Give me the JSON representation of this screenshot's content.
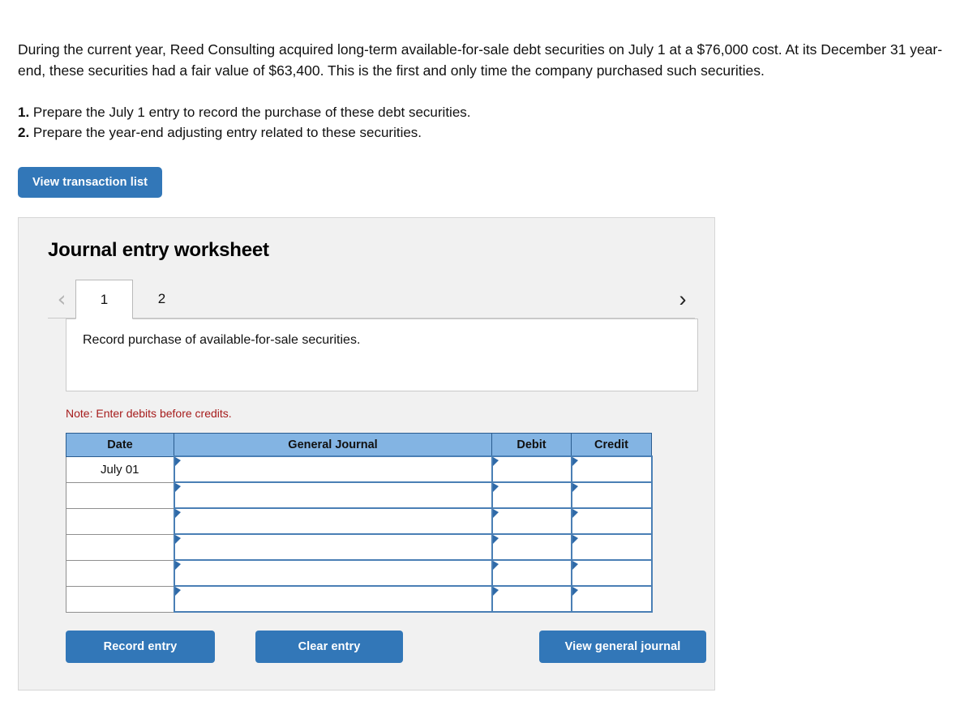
{
  "problem": {
    "statement": "During the current year, Reed Consulting acquired long-term available-for-sale debt securities on July 1 at a $76,000 cost. At its December 31 year-end, these securities had a fair value of $63,400. This is the first and only time the company purchased such securities.",
    "requirements": [
      {
        "number": "1.",
        "text": "Prepare the July 1 entry to record the purchase of these debt securities."
      },
      {
        "number": "2.",
        "text": "Prepare the year-end adjusting entry related to these securities."
      }
    ]
  },
  "toolbar": {
    "view_transaction_list_label": "View transaction list"
  },
  "worksheet": {
    "title": "Journal entry worksheet",
    "nav": {
      "prev_icon": "chevron-left-icon",
      "next_icon": "chevron-right-icon",
      "prev_glyph": "‹",
      "next_glyph": "›"
    },
    "tabs": [
      {
        "label": "1",
        "active": true
      },
      {
        "label": "2",
        "active": false
      }
    ],
    "description": "Record purchase of available-for-sale securities.",
    "note": "Note: Enter debits before credits.",
    "table": {
      "columns": [
        "Date",
        "General Journal",
        "Debit",
        "Credit"
      ],
      "rows": [
        {
          "date": "July 01",
          "general_journal": "",
          "debit": "",
          "credit": ""
        },
        {
          "date": "",
          "general_journal": "",
          "debit": "",
          "credit": ""
        },
        {
          "date": "",
          "general_journal": "",
          "debit": "",
          "credit": ""
        },
        {
          "date": "",
          "general_journal": "",
          "debit": "",
          "credit": ""
        },
        {
          "date": "",
          "general_journal": "",
          "debit": "",
          "credit": ""
        },
        {
          "date": "",
          "general_journal": "",
          "debit": "",
          "credit": ""
        }
      ]
    },
    "buttons": {
      "record_entry_label": "Record entry",
      "clear_entry_label": "Clear entry",
      "view_general_journal_label": "View general journal"
    }
  },
  "colors": {
    "accent_blue": "#3277b8",
    "header_blue": "#83b4e3",
    "cell_border_blue": "#4a7fb5",
    "note_red": "#a61c1c",
    "panel_bg": "#f1f1f1"
  }
}
